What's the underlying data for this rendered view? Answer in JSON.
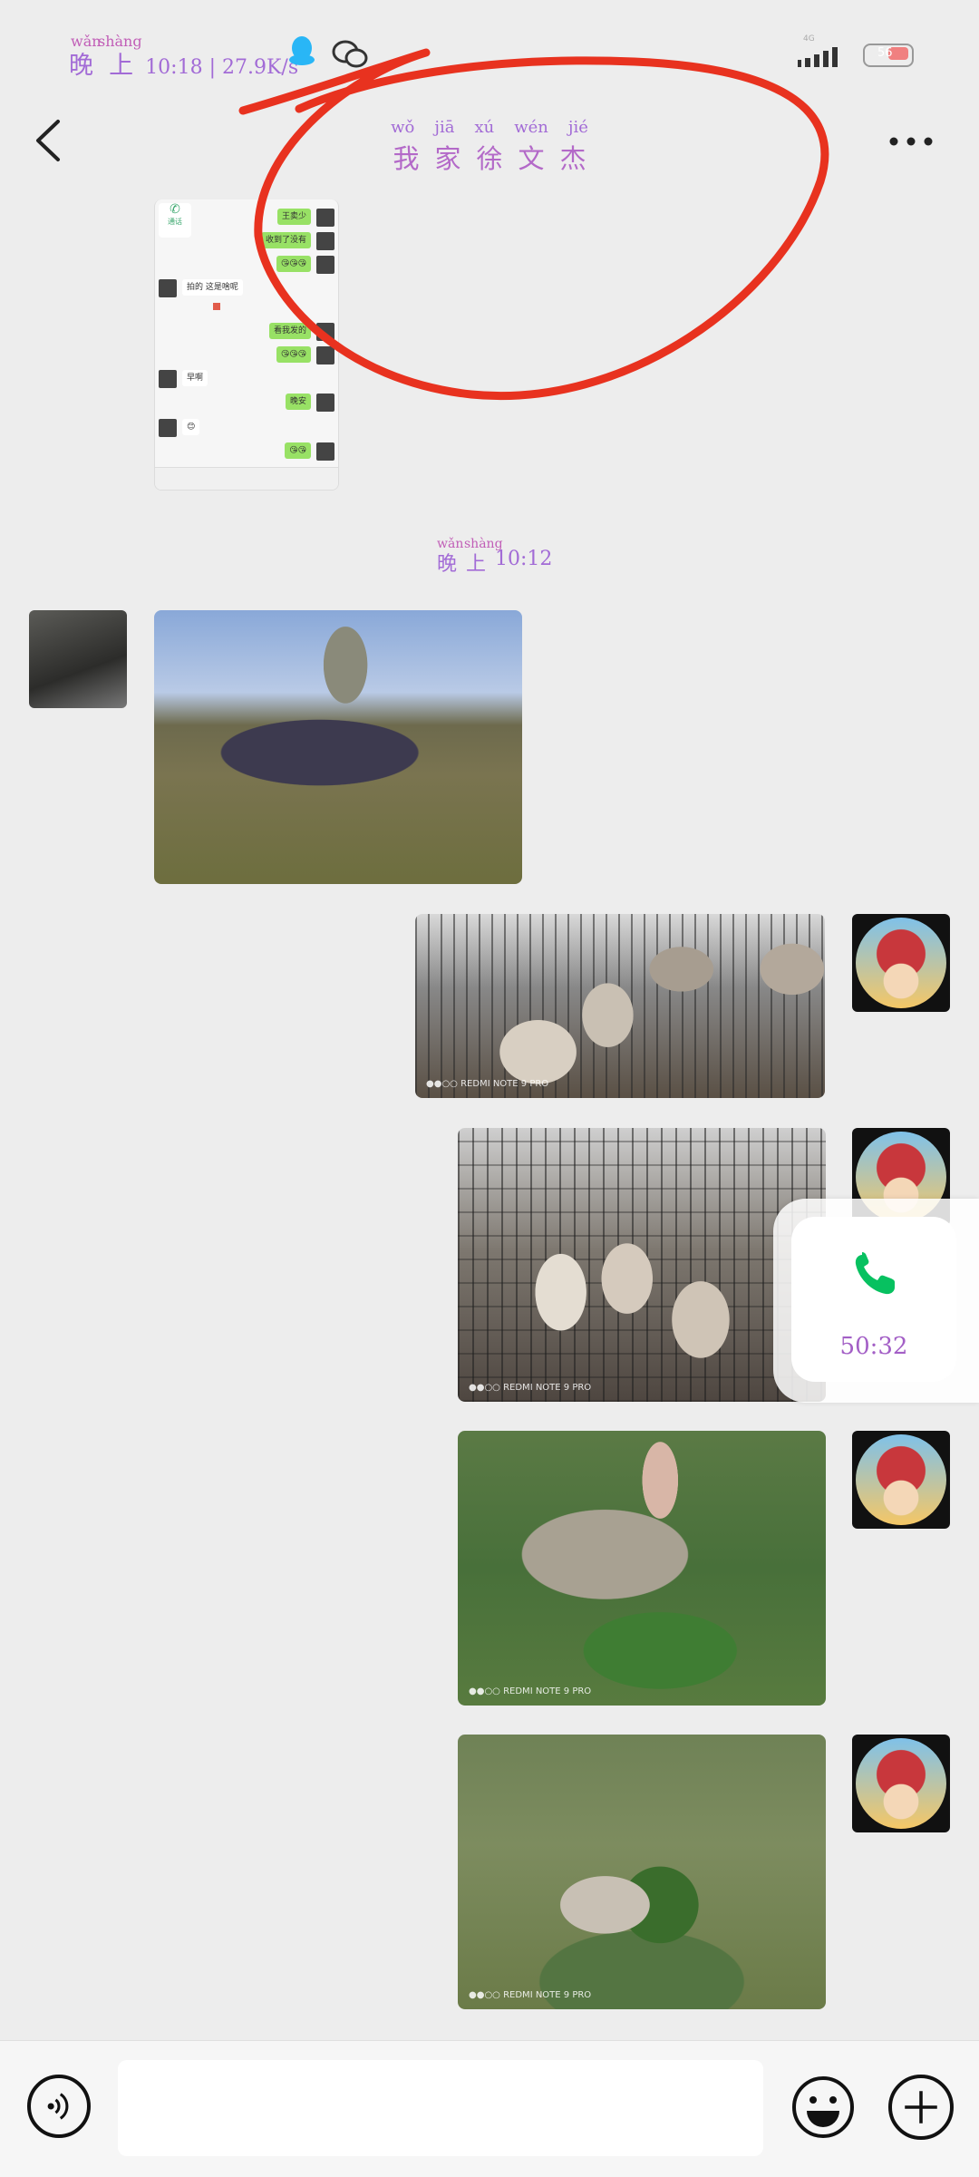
{
  "status_bar": {
    "time_pinyin": [
      "wǎn",
      "shàng"
    ],
    "time_hanzi": [
      "晚",
      "上"
    ],
    "time_rest": "10:18 | 27.9K/s",
    "network": "4G",
    "battery": "56"
  },
  "header": {
    "title_pinyin": [
      "wǒ",
      "jiā",
      "xú",
      "wén",
      "jié"
    ],
    "title_hanzi": [
      "我",
      "家",
      "徐",
      "文",
      "杰"
    ]
  },
  "snippet": {
    "call_label": "通话",
    "messages": [
      {
        "side": "right",
        "text": "王卖少"
      },
      {
        "side": "right",
        "text": "收到了没有"
      },
      {
        "side": "right",
        "text": "😘😘😘"
      },
      {
        "side": "left",
        "text": "拍的 这是啥呢"
      },
      {
        "side": "right",
        "text": "看我发的"
      },
      {
        "side": "right",
        "text": "😘😘😘"
      },
      {
        "side": "left",
        "text": "早啊"
      },
      {
        "side": "right",
        "text": "晚安"
      },
      {
        "side": "left",
        "text": "😊"
      },
      {
        "side": "right",
        "text": "😘😘"
      }
    ]
  },
  "timestamp": {
    "pinyin": [
      "wǎn",
      "shàng"
    ],
    "hanzi": [
      "晚",
      "上"
    ],
    "time": "10:12"
  },
  "images": {
    "watermark": "REDMI NOTE 9 PRO"
  },
  "call": {
    "duration": "50:32"
  },
  "colors": {
    "accent_purple": "#a26bd6",
    "call_green": "#07c160",
    "scribble_red": "#e8321f",
    "bubble_green": "#98e165"
  }
}
